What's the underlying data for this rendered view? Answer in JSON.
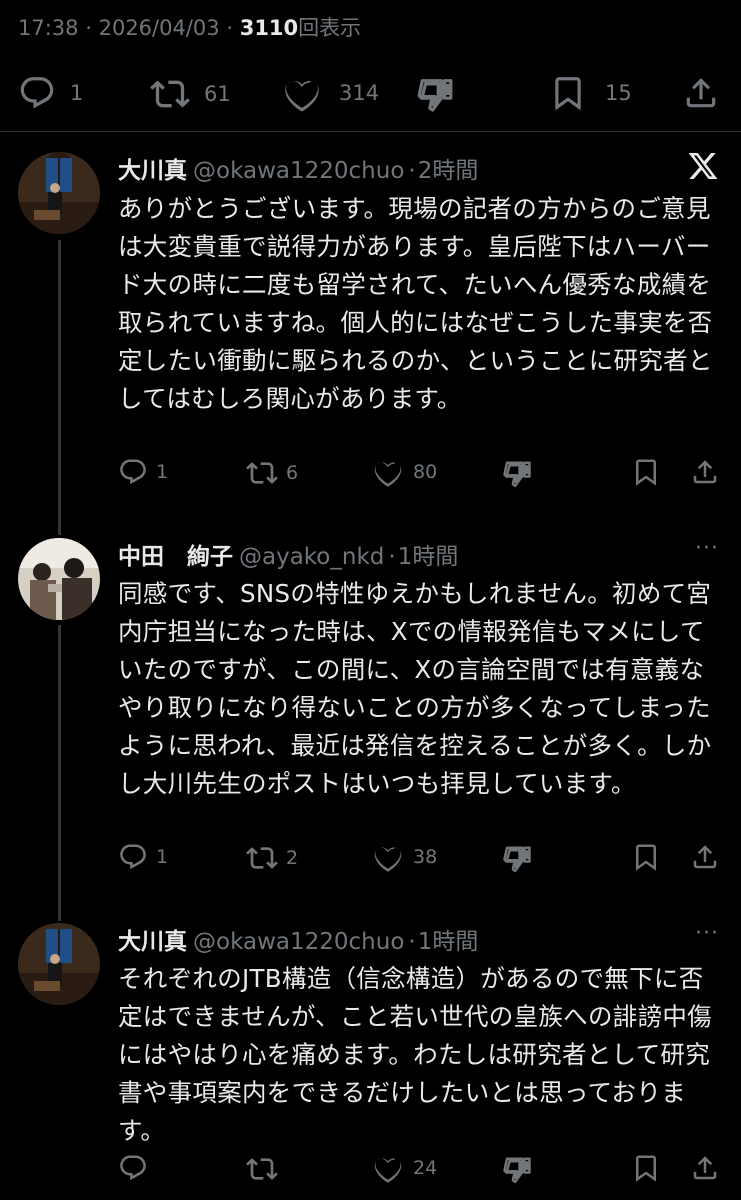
{
  "header": {
    "time": "17:38",
    "date": "2026/04/03",
    "views_count": "3110",
    "views_label": "回表示"
  },
  "main_actions": {
    "replies": "1",
    "reposts": "61",
    "likes": "314",
    "bookmarks": "15"
  },
  "replies": [
    {
      "name": "大川真",
      "handle": "@okawa1220chuo",
      "time": "2時間",
      "text": "ありがとうございます。現場の記者の方からのご意見は大変貴重で説得力があります。皇后陛下はハーバード大の時に二度も留学されて、たいへん優秀な成績を取られていますね。個人的にはなぜこうした事実を否定したい衝動に駆られるのか、ということに研究者としてはむしろ関心があります。",
      "reply_count": "1",
      "repost_count": "6",
      "like_count": "80"
    },
    {
      "name": "中田　絢子",
      "handle": "@ayako_nkd",
      "time": "1時間",
      "text": "同感です、SNSの特性ゆえかもしれません。初めて宮内庁担当になった時は、Xでの情報発信もマメにしていたのですが、この間に、Xの言論空間では有意義なやり取りになり得ないことの方が多くなってしまったように思われ、最近は発信を控えることが多く。しかし大川先生のポストはいつも拝見しています。",
      "reply_count": "1",
      "repost_count": "2",
      "like_count": "38"
    },
    {
      "name": "大川真",
      "handle": "@okawa1220chuo",
      "time": "1時間",
      "text": "それぞれのJTB構造（信念構造）があるので無下に否定はできませんが、こと若い世代の皇族への誹謗中傷にはやはり心を痛めます。わたしは研究者として研究書や事項案内をできるだけしたいとは思っております。",
      "reply_count": "",
      "repost_count": "",
      "like_count": "24"
    }
  ],
  "separator": "·",
  "more_label": "···",
  "colors": {
    "background": "#000000",
    "text": "#e7e9ea",
    "muted": "#71767b",
    "divider": "#2f3336"
  }
}
